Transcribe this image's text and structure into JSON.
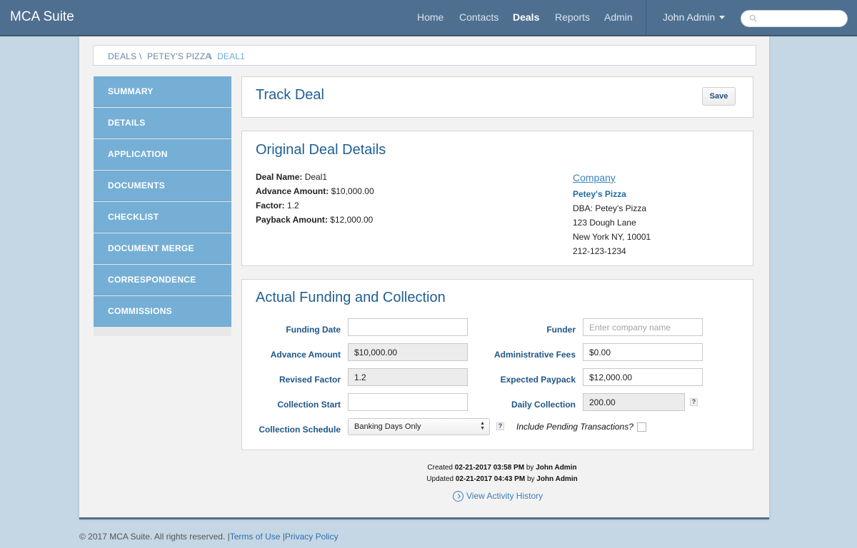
{
  "app": {
    "brand": "MCA Suite"
  },
  "nav": {
    "items": [
      "Home",
      "Contacts",
      "Deals",
      "Reports",
      "Admin"
    ],
    "active": "Deals",
    "user": "John Admin",
    "search_placeholder": ""
  },
  "breadcrumb": [
    "DEALS",
    "PETEY'S PIZZA",
    "DEAL1"
  ],
  "breadcrumb_sep": "\\",
  "sidebar": {
    "items": [
      "SUMMARY",
      "DETAILS",
      "APPLICATION",
      "DOCUMENTS",
      "CHECKLIST",
      "DOCUMENT MERGE",
      "CORRESPONDENCE",
      "COMMISSIONS"
    ]
  },
  "track": {
    "title": "Track Deal",
    "save_label": "Save"
  },
  "original": {
    "title": "Original Deal Details",
    "fields": [
      {
        "label": "Deal Name:",
        "value": "Deal1"
      },
      {
        "label": "Advance Amount:",
        "value": "$10,000.00"
      },
      {
        "label": "Factor:",
        "value": "1.2"
      },
      {
        "label": "Payback Amount:",
        "value": "$12,000.00"
      }
    ],
    "company": {
      "heading": "Company",
      "name": "Petey's Pizza",
      "dba": "DBA: Petey's Pizza",
      "address1": "123 Dough Lane",
      "address2": "New York NY, 10001",
      "phone": "212-123-1234"
    }
  },
  "actual": {
    "title": "Actual Funding and Collection",
    "funding_date": {
      "label": "Funding Date",
      "value": ""
    },
    "advance_amount": {
      "label": "Advance Amount",
      "value": "$10,000.00"
    },
    "revised_factor": {
      "label": "Revised Factor",
      "value": "1.2"
    },
    "collection_start": {
      "label": "Collection Start",
      "value": ""
    },
    "collection_schedule": {
      "label": "Collection Schedule",
      "value": "Banking Days Only"
    },
    "funder": {
      "label": "Funder",
      "value": "",
      "placeholder": "Enter company name"
    },
    "admin_fees": {
      "label": "Administrative Fees",
      "value": "$0.00"
    },
    "expected_payback": {
      "label": "Expected Paypack",
      "value": "$12,000.00"
    },
    "daily_collection": {
      "label": "Daily Collection",
      "value": "200.00"
    },
    "help": "?",
    "pending": {
      "label": "Include Pending Transactions?",
      "checked": false
    }
  },
  "meta": {
    "created_label": "Created",
    "created_at": "02-21-2017 03:58 PM",
    "created_by": "John Admin",
    "updated_label": "Updated",
    "updated_at": "02-21-2017 04:43 PM",
    "updated_by": "John Admin",
    "by": "by"
  },
  "activity": {
    "label": "View Activity History"
  },
  "footer": {
    "copyright": "© 2017 MCA Suite. All rights reserved.",
    "sep": "|",
    "terms": "Terms of Use",
    "privacy": "Privacy Policy"
  }
}
